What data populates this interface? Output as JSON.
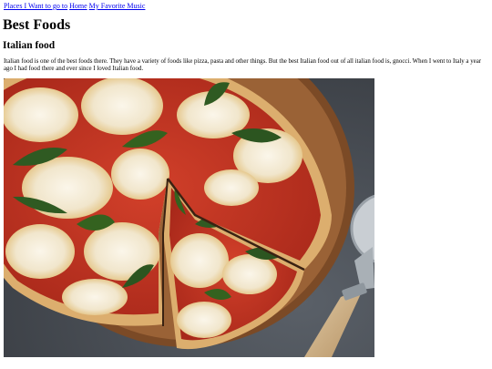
{
  "nav": {
    "links": [
      "Places I Want to go to",
      "Home",
      "My Favorite Music"
    ]
  },
  "page_title": "Best Foods",
  "section": {
    "heading": "Italian food",
    "paragraph": "Italian food is one of the best foods there. They have a variety of foods like pizza, pasta and other things. But the best Italian food out of all italian food is, gnocci. When I went to Italy a year ago I had food there and ever since I loved Italian food."
  },
  "image": {
    "alt": "",
    "subject": "margherita pizza on a wooden board with a pizza cutter"
  },
  "colors": {
    "link": "#0000ee",
    "text": "#000000",
    "background": "#ffffff"
  }
}
